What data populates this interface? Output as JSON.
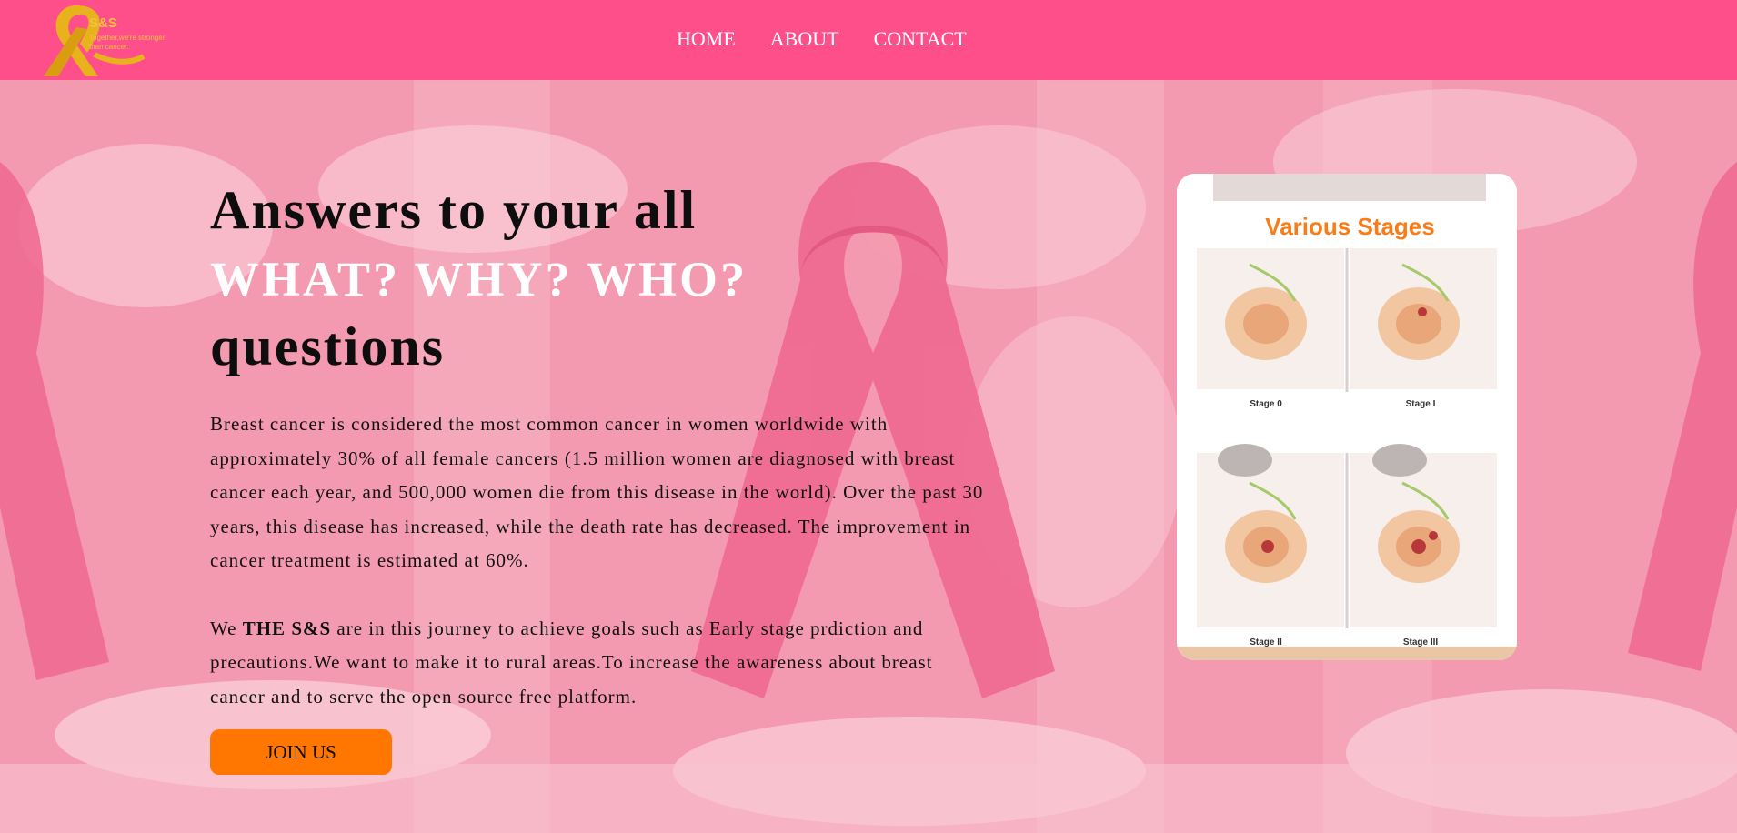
{
  "brand": {
    "name": "S&S",
    "tagline": "Together,we're stronger than cancer."
  },
  "nav": {
    "links": [
      "HOME",
      "ABOUT",
      "CONTACT"
    ]
  },
  "hero": {
    "heading_line1": "Answers to your all",
    "heading_accent": "WHAT? WHY? WHO?",
    "heading_line3": "questions",
    "paragraph1": "Breast cancer is considered the most common cancer in women worldwide with approximately 30% of all female cancers (1.5 million women are diagnosed with breast cancer each year, and 500,000 women die from this disease in the world). Over the past 30 years, this disease has increased, while the death rate has decreased. The improvement in cancer treatment is estimated at 60%.",
    "paragraph2_prefix": "We ",
    "paragraph2_bold": "THE S&S",
    "paragraph2_suffix": " are in this journey to achieve goals such as Early stage prdiction and precautions.We want to make it to rural areas.To increase the awareness about breast cancer and to serve the open source free platform.",
    "join_button": "JOIN US"
  },
  "stages_card": {
    "title": "Various Stages",
    "stages": [
      "Stage 0",
      "Stage I",
      "Stage II",
      "Stage III"
    ]
  },
  "colors": {
    "navbar": "#ff4f8b",
    "hero_bg": "#f49ab0",
    "button": "#ff7700",
    "card_title": "#f77d1a",
    "logo": "#f2c23b"
  }
}
